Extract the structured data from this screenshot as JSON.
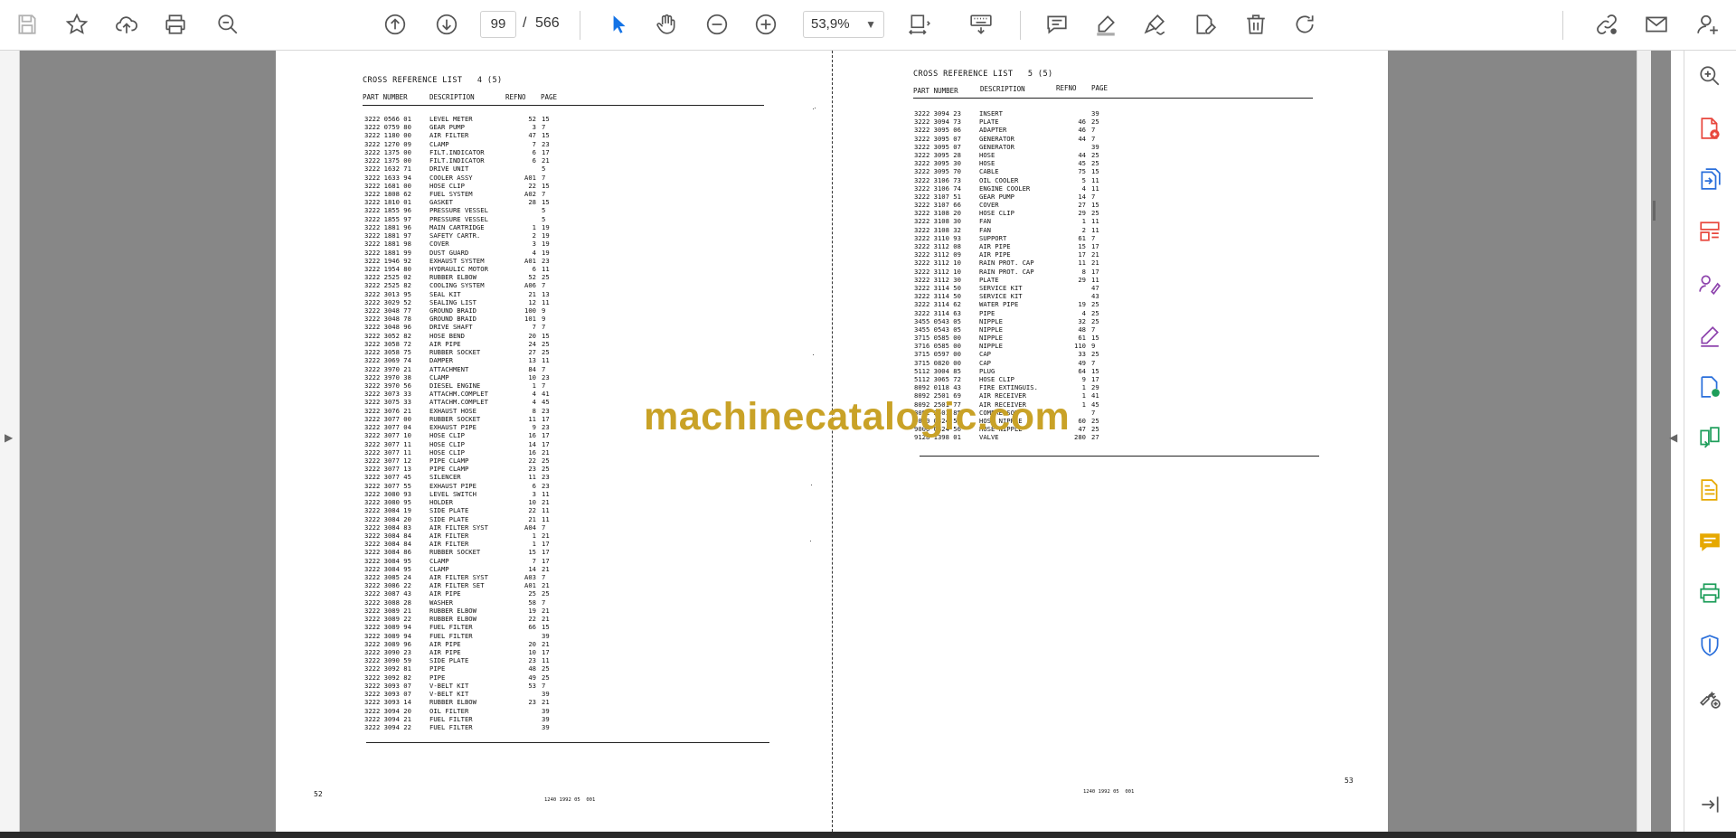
{
  "toolbar": {
    "page_current": "99",
    "page_separator": "/",
    "page_total": "566",
    "zoom": "53,9%",
    "icons_left": [
      "save-icon",
      "bookmark-star-icon",
      "upload-cloud-icon",
      "print-icon",
      "search-zoom-icon"
    ],
    "icons_nav": [
      "page-up-icon",
      "page-down-icon"
    ],
    "icons_tools": [
      "select-cursor-icon",
      "hand-tool-icon",
      "zoom-out-icon",
      "zoom-in-icon"
    ],
    "icons_right": [
      "fit-page-icon",
      "keyboard-icon",
      "comment-icon",
      "highlight-pen-icon",
      "sign-icon",
      "edit-pdf-icon",
      "delete-icon",
      "rotate-icon",
      "share-link-icon",
      "email-icon",
      "add-user-icon"
    ]
  },
  "right_panel": {
    "icons": [
      "zoom-search-icon",
      "create-pdf-icon",
      "export-pdf-icon",
      "organize-pages-icon",
      "fill-sign-icon",
      "edit-text-icon",
      "send-review-icon",
      "compare-icon",
      "scan-ocr-icon",
      "comment-panel-icon",
      "print-production-icon",
      "protect-icon",
      "more-tools-icon",
      "collapse-panel-icon"
    ]
  },
  "watermark": "machinecatalogic.com",
  "colors": {
    "viewer_bg": "#878787",
    "accent_blue": "#1473e6",
    "watermark": "#c9a227",
    "right_panel_red": "#e8473d",
    "right_panel_blue": "#2a6fdb",
    "right_panel_purple": "#8e44ad",
    "right_panel_green": "#1e9e5b",
    "right_panel_yellow": "#e6a800"
  },
  "left_page": {
    "title": "CROSS REFERENCE LIST   4 (5)",
    "headers": {
      "part": "PART NUMBER",
      "desc": "DESCRIPTION",
      "ref": "REFNO",
      "page": "PAGE"
    },
    "rows": [
      [
        "3222 0566 01",
        "LEVEL METER",
        "52",
        "15"
      ],
      [
        "3222 0759 80",
        "GEAR PUMP",
        "3",
        "7"
      ],
      [
        "3222 1180 00",
        "AIR FILTER",
        "47",
        "15"
      ],
      [
        "3222 1270 09",
        "CLAMP",
        "7",
        "23"
      ],
      [
        "3222 1375 00",
        "FILT.INDICATOR",
        "6",
        "17"
      ],
      [
        "3222 1375 00",
        "FILT.INDICATOR",
        "6",
        "21"
      ],
      [
        "3222 1632 71",
        "DRIVE UNIT",
        "",
        "5"
      ],
      [
        "3222 1633 94",
        "COOLER ASSY",
        "A01",
        "7"
      ],
      [
        "3222 1681 00",
        "HOSE CLIP",
        "22",
        "15"
      ],
      [
        "3222 1808 62",
        "FUEL SYSTEM",
        "A02",
        "7"
      ],
      [
        "3222 1810 01",
        "GASKET",
        "28",
        "15"
      ],
      [
        "3222 1855 96",
        "PRESSURE VESSEL",
        "",
        "5"
      ],
      [
        "3222 1855 97",
        "PRESSURE VESSEL",
        "",
        "5"
      ],
      [
        "3222 1881 96",
        "MAIN CARTRIDGE",
        "1",
        "19"
      ],
      [
        "3222 1881 97",
        "SAFETY CARTR.",
        "2",
        "19"
      ],
      [
        "3222 1881 98",
        "COVER",
        "3",
        "19"
      ],
      [
        "3222 1881 99",
        "DUST GUARD",
        "4",
        "19"
      ],
      [
        "3222 1946 92",
        "EXHAUST SYSTEM",
        "A01",
        "23"
      ],
      [
        "3222 1954 80",
        "HYDRAULIC MOTOR",
        "6",
        "11"
      ],
      [
        "3222 2525 02",
        "RUBBER ELBOW",
        "52",
        "25"
      ],
      [
        "3222 2525 82",
        "COOLING SYSTEM",
        "A06",
        "7"
      ],
      [
        "3222 3013 95",
        "SEAL KIT",
        "21",
        "13"
      ],
      [
        "3222 3029 52",
        "SEALING LIST",
        "12",
        "11"
      ],
      [
        "3222 3048 77",
        "GROUND BRAID",
        "100",
        "9"
      ],
      [
        "3222 3048 78",
        "GROUND BRAID",
        "101",
        "9"
      ],
      [
        "3222 3048 96",
        "DRIVE SHAFT",
        "7",
        "7"
      ],
      [
        "3222 3052 82",
        "HOSE BEND",
        "20",
        "15"
      ],
      [
        "3222 3058 72",
        "AIR PIPE",
        "24",
        "25"
      ],
      [
        "3222 3058 75",
        "RUBBER SOCKET",
        "27",
        "25"
      ],
      [
        "3222 3069 74",
        "DAMPER",
        "13",
        "11"
      ],
      [
        "3222 3970 21",
        "ATTACHMENT",
        "84",
        "7"
      ],
      [
        "3222 3970 38",
        "CLAMP",
        "10",
        "23"
      ],
      [
        "3222 3970 56",
        "DIESEL ENGINE",
        "1",
        "7"
      ],
      [
        "3222 3073 33",
        "ATTACHM.COMPLET",
        "4",
        "41"
      ],
      [
        "3222 3075 33",
        "ATTACHM.COMPLET",
        "4",
        "45"
      ],
      [
        "3222 3076 21",
        "EXHAUST HOSE",
        "8",
        "23"
      ],
      [
        "3222 3077 00",
        "RUBBER SOCKET",
        "11",
        "17"
      ],
      [
        "3222 3077 04",
        "EXHAUST PIPE",
        "9",
        "23"
      ],
      [
        "3222 3077 10",
        "HOSE CLIP",
        "16",
        "17"
      ],
      [
        "3222 3077 11",
        "HOSE CLIP",
        "14",
        "17"
      ],
      [
        "3222 3077 11",
        "HOSE CLIP",
        "16",
        "21"
      ],
      [
        "3222 3077 12",
        "PIPE CLAMP",
        "22",
        "25"
      ],
      [
        "3222 3077 13",
        "PIPE CLAMP",
        "23",
        "25"
      ],
      [
        "3222 3077 45",
        "SILENCER",
        "11",
        "23"
      ],
      [
        "3222 3077 55",
        "EXHAUST PIPE",
        "6",
        "23"
      ],
      [
        "3222 3080 93",
        "LEVEL SWITCH",
        "3",
        "11"
      ],
      [
        "3222 3080 95",
        "HOLDER",
        "10",
        "21"
      ],
      [
        "3222 3084 19",
        "SIDE PLATE",
        "22",
        "11"
      ],
      [
        "3222 3084 20",
        "SIDE PLATE",
        "21",
        "11"
      ],
      [
        "3222 3084 83",
        "AIR FILTER SYST",
        "A04",
        "7"
      ],
      [
        "3222 3084 84",
        "AIR FILTER",
        "1",
        "21"
      ],
      [
        "3222 3084 84",
        "AIR FILTER",
        "1",
        "17"
      ],
      [
        "3222 3084 86",
        "RUBBER SOCKET",
        "15",
        "17"
      ],
      [
        "3222 3084 95",
        "CLAMP",
        "7",
        "17"
      ],
      [
        "3222 3084 95",
        "CLAMP",
        "14",
        "21"
      ],
      [
        "3222 3085 24",
        "AIR FILTER SYST",
        "A03",
        "7"
      ],
      [
        "3222 3086 22",
        "AIR FILTER SET",
        "A01",
        "21"
      ],
      [
        "3222 3087 43",
        "AIR PIPE",
        "25",
        "25"
      ],
      [
        "3222 3088 28",
        "WASHER",
        "58",
        "7"
      ],
      [
        "3222 3089 21",
        "RUBBER ELBOW",
        "19",
        "21"
      ],
      [
        "3222 3089 22",
        "RUBBER ELBOW",
        "22",
        "21"
      ],
      [
        "3222 3089 94",
        "FUEL FILTER",
        "66",
        "15"
      ],
      [
        "3222 3089 94",
        "FUEL FILTER",
        "",
        "39"
      ],
      [
        "3222 3089 96",
        "AIR PIPE",
        "20",
        "21"
      ],
      [
        "3222 3090 23",
        "AIR PIPE",
        "10",
        "17"
      ],
      [
        "3222 3090 59",
        "SIDE PLATE",
        "23",
        "11"
      ],
      [
        "3222 3092 81",
        "PIPE",
        "48",
        "25"
      ],
      [
        "3222 3092 82",
        "PIPE",
        "49",
        "25"
      ],
      [
        "3222 3093 07",
        "V-BELT KIT",
        "53",
        "7"
      ],
      [
        "3222 3093 07",
        "V-BELT KIT",
        "",
        "39"
      ],
      [
        "3222 3093 14",
        "RUBBER ELBOW",
        "23",
        "21"
      ],
      [
        "3222 3094 20",
        "OIL FILTER",
        "",
        "39"
      ],
      [
        "3222 3094 21",
        "FUEL FILTER",
        "",
        "39"
      ],
      [
        "3222 3094 22",
        "FUEL FILTER",
        "",
        "39"
      ]
    ],
    "page_number": "52",
    "doc_code": "1240 1992 05  001"
  },
  "right_page": {
    "title": "CROSS REFERENCE LIST   5 (5)",
    "headers": {
      "part": "PART NUMBER",
      "desc": "DESCRIPTION",
      "ref": "REFNO",
      "page": "PAGE"
    },
    "rows": [
      [
        "3222 3094 23",
        "INSERT",
        "",
        "39"
      ],
      [
        "3222 3094 73",
        "PLATE",
        "46",
        "25"
      ],
      [
        "3222 3095 06",
        "ADAPTER",
        "46",
        "7"
      ],
      [
        "3222 3095 07",
        "GENERATOR",
        "44",
        "7"
      ],
      [
        "3222 3095 07",
        "GENERATOR",
        "",
        "39"
      ],
      [
        "3222 3095 28",
        "HOSE",
        "44",
        "25"
      ],
      [
        "3222 3095 30",
        "HOSE",
        "45",
        "25"
      ],
      [
        "3222 3095 70",
        "CABLE",
        "75",
        "15"
      ],
      [
        "3222 3106 73",
        "OIL COOLER",
        "5",
        "11"
      ],
      [
        "3222 3106 74",
        "ENGINE COOLER",
        "4",
        "11"
      ],
      [
        "3222 3107 51",
        "GEAR PUMP",
        "14",
        "7"
      ],
      [
        "3222 3107 66",
        "COVER",
        "27",
        "15"
      ],
      [
        "3222 3108 20",
        "HOSE CLIP",
        "29",
        "25"
      ],
      [
        "3222 3108 30",
        "FAN",
        "1",
        "11"
      ],
      [
        "3222 3108 32",
        "FAN",
        "2",
        "11"
      ],
      [
        "3222 3110 93",
        "SUPPORT",
        "61",
        "7"
      ],
      [
        "3222 3112 08",
        "AIR PIPE",
        "15",
        "17"
      ],
      [
        "3222 3112 09",
        "AIR PIPE",
        "17",
        "21"
      ],
      [
        "3222 3112 10",
        "RAIN PROT. CAP",
        "11",
        "21"
      ],
      [
        "3222 3112 10",
        "RAIN PROT. CAP",
        "8",
        "17"
      ],
      [
        "3222 3112 30",
        "PLATE",
        "29",
        "11"
      ],
      [
        "3222 3114 50",
        "SERVICE KIT",
        "",
        "47"
      ],
      [
        "3222 3114 50",
        "SERVICE KIT",
        "",
        "43"
      ],
      [
        "3222 3114 62",
        "WATER PIPE",
        "19",
        "25"
      ],
      [
        "3222 3114 63",
        "PIPE",
        "4",
        "25"
      ],
      [
        "3455 0543 05",
        "NIPPLE",
        "32",
        "25"
      ],
      [
        "3455 0543 05",
        "NIPPLE",
        "48",
        "7"
      ],
      [
        "3715 0585 00",
        "NIPPLE",
        "61",
        "15"
      ],
      [
        "3716 0585 00",
        "NIPPLE",
        "110",
        "9"
      ],
      [
        "3715 0597 00",
        "CAP",
        "33",
        "25"
      ],
      [
        "3715 0820 00",
        "CAP",
        "49",
        "7"
      ],
      [
        "5112 3004 85",
        "PLUG",
        "64",
        "15"
      ],
      [
        "5112 3065 72",
        "HOSE CLIP",
        "9",
        "17"
      ],
      [
        "8092 0118 43",
        "FIRE EXTINGUIS.",
        "1",
        "29"
      ],
      [
        "8092 2501 69",
        "AIR RECEIVER",
        "1",
        "41"
      ],
      [
        "8092 2501 77",
        "AIR RECEIVER",
        "1",
        "45"
      ],
      [
        "8092 2501 85",
        "COMPRESSOR",
        "",
        "7"
      ],
      [
        "9000 0324 51",
        "HOSE NIPPLE",
        "60",
        "25"
      ],
      [
        "9000 0324 56",
        "HOSE NIPPLE",
        "47",
        "25"
      ],
      [
        "9128 1398 01",
        "VALVE",
        "280",
        "27"
      ]
    ],
    "page_number": "53",
    "doc_code": "1240 1992 05  001"
  }
}
